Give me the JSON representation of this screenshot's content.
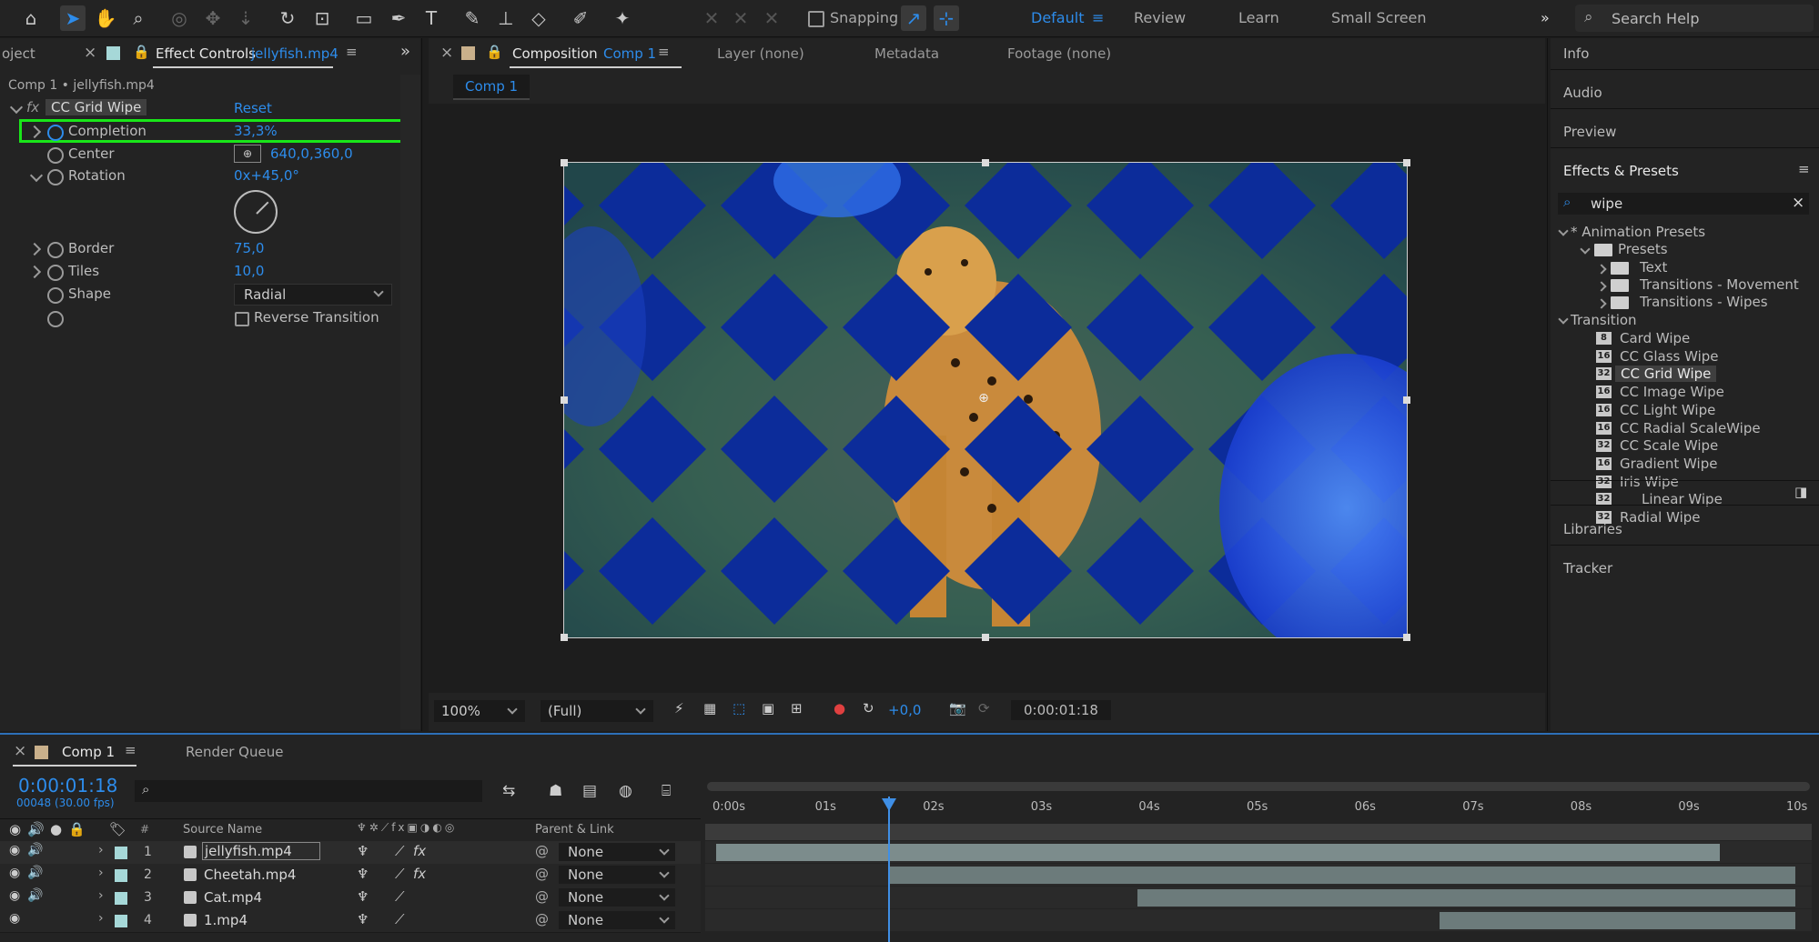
{
  "toolbar": {
    "snapping_label": "Snapping",
    "workspaces": [
      "Default",
      "Review",
      "Learn",
      "Small Screen"
    ],
    "search_placeholder": "Search Help"
  },
  "left_panel": {
    "tab_project": "oject",
    "tab_effect_prefix": "Effect Controls",
    "tab_effect_file": "jellyfish.mp4",
    "subtitle": "Comp 1 • jellyfish.mp4",
    "effect_name": "CC Grid Wipe",
    "reset_label": "Reset",
    "properties": {
      "completion": {
        "label": "Completion",
        "value": "33,3%"
      },
      "center": {
        "label": "Center",
        "value": "640,0,360,0"
      },
      "rotation": {
        "label": "Rotation",
        "value": "0x+45,0°"
      },
      "border": {
        "label": "Border",
        "value": "75,0"
      },
      "tiles": {
        "label": "Tiles",
        "value": "10,0"
      },
      "shape": {
        "label": "Shape",
        "value": "Radial"
      },
      "reverse": {
        "label": "Reverse Transition"
      }
    }
  },
  "center_panel": {
    "tab_prefix": "Composition",
    "tab_comp": "Comp 1",
    "tab_layer": "Layer (none)",
    "tab_metadata": "Metadata",
    "tab_footage": "Footage (none)",
    "comp_breadcrumb": "Comp 1",
    "zoom": "100%",
    "resolution": "(Full)",
    "exposure": "+0,0",
    "timecode": "0:00:01:18"
  },
  "right_panel": {
    "info": "Info",
    "audio": "Audio",
    "preview": "Preview",
    "effects_title": "Effects & Presets",
    "search_value": "wipe",
    "tree": {
      "animation_presets": "* Animation Presets",
      "presets": "Presets",
      "text": "Text",
      "transitions_movement": "Transitions - Movement",
      "transitions_wipes": "Transitions - Wipes",
      "transition": "Transition"
    },
    "effects": [
      {
        "name": "Card Wipe",
        "badge": "8"
      },
      {
        "name": "CC Glass Wipe",
        "badge": "16"
      },
      {
        "name": "CC Grid Wipe",
        "badge": "32"
      },
      {
        "name": "CC Image Wipe",
        "badge": "16"
      },
      {
        "name": "CC Light Wipe",
        "badge": "16"
      },
      {
        "name": "CC Radial ScaleWipe",
        "badge": "16"
      },
      {
        "name": "CC Scale Wipe",
        "badge": "32"
      },
      {
        "name": "Gradient Wipe",
        "badge": "16"
      },
      {
        "name": "Iris Wipe",
        "badge": "32"
      },
      {
        "name": "Linear Wipe",
        "badge": "32"
      },
      {
        "name": "Radial Wipe",
        "badge": "32"
      }
    ],
    "libraries": "Libraries",
    "tracker": "Tracker"
  },
  "timeline": {
    "tab_comp": "Comp 1",
    "tab_render": "Render Queue",
    "timecode": "0:00:01:18",
    "frame_info": "00048 (30.00 fps)",
    "col_number": "#",
    "col_source": "Source Name",
    "col_parent": "Parent & Link",
    "ruler": [
      "0:00s",
      "01s",
      "02s",
      "03s",
      "04s",
      "05s",
      "06s",
      "07s",
      "08s",
      "09s",
      "10s"
    ],
    "ruler_end_seconds": 10,
    "playhead_seconds": 1.6,
    "layers": [
      {
        "num": "1",
        "name": "jellyfish.mp4",
        "parent": "None",
        "fx": true,
        "start_s": 0.0,
        "end_s": 9.3
      },
      {
        "num": "2",
        "name": "Cheetah.mp4",
        "parent": "None",
        "fx": true,
        "start_s": 1.6,
        "end_s": 10.0
      },
      {
        "num": "3",
        "name": "Cat.mp4",
        "parent": "None",
        "fx": false,
        "start_s": 3.9,
        "end_s": 10.0
      },
      {
        "num": "4",
        "name": "1.mp4",
        "parent": "None",
        "fx": false,
        "start_s": 6.7,
        "end_s": 10.0
      }
    ]
  },
  "colors": {
    "accent": "#2d8ceb",
    "highlight_box": "#19e619",
    "layer_label": "#a6d8d8"
  }
}
